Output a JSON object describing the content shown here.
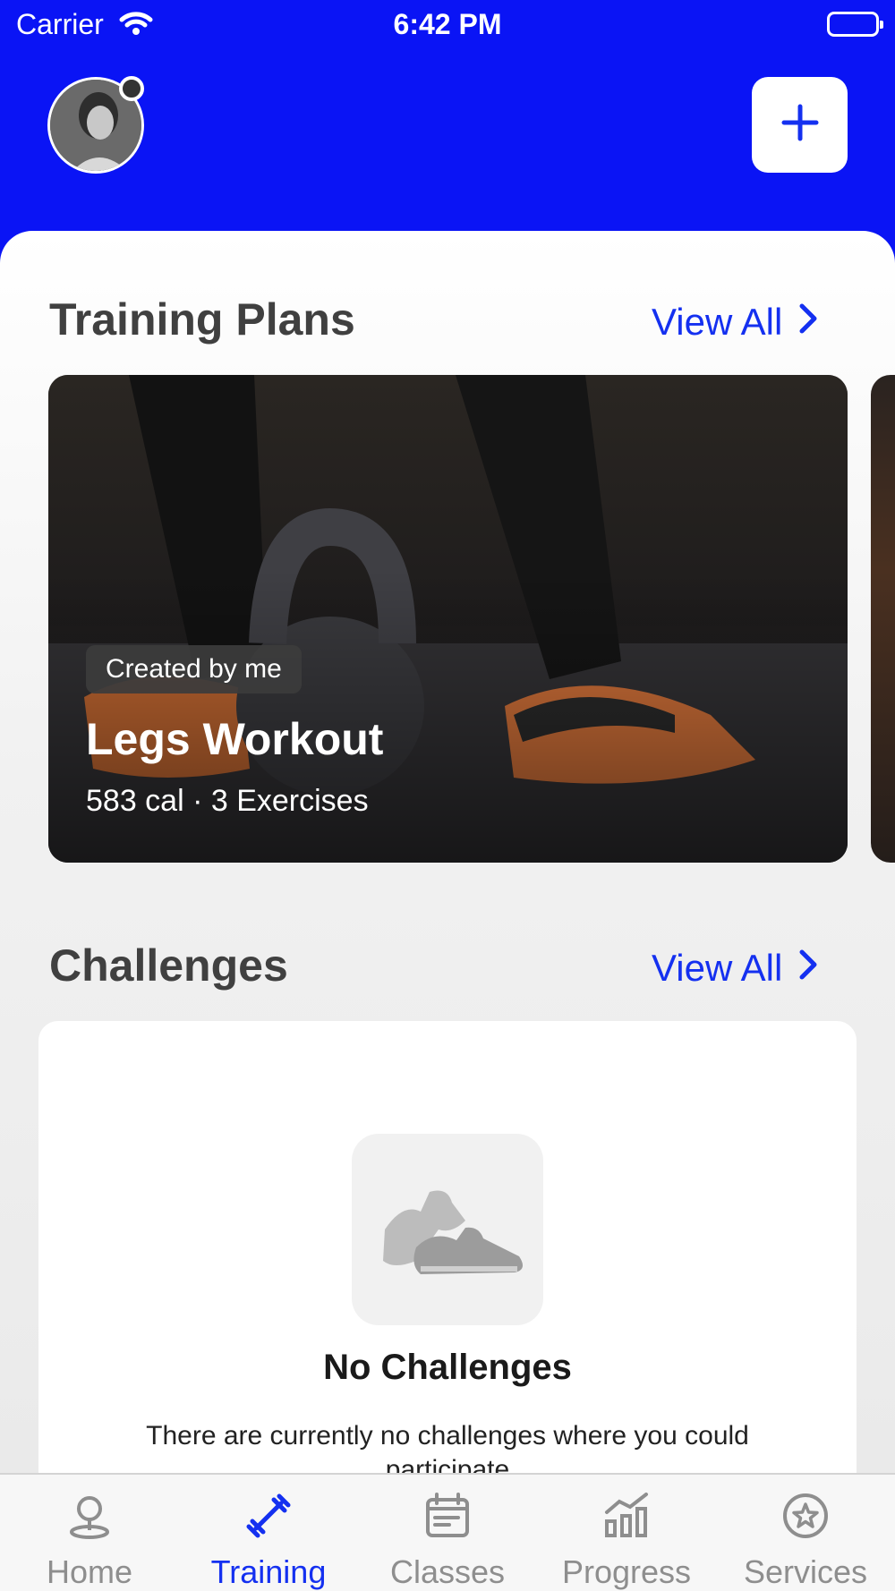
{
  "status_bar": {
    "carrier": "Carrier",
    "time": "6:42 PM",
    "wifi_icon": "wifi-icon",
    "battery_icon": "battery-icon"
  },
  "header": {
    "avatar": "user-avatar",
    "add_icon": "plus-icon"
  },
  "training_plans": {
    "title": "Training Plans",
    "view_all": "View All",
    "cards": [
      {
        "badge": "Created by me",
        "title": "Legs Workout",
        "meta": "583 cal · 3 Exercises"
      }
    ]
  },
  "challenges": {
    "title": "Challenges",
    "view_all": "View All",
    "empty_title": "No Challenges",
    "empty_text": "There are currently no challenges where you could participate"
  },
  "tab_bar": {
    "active_index": 1,
    "tabs": [
      {
        "label": "Home",
        "icon": "home-location-icon"
      },
      {
        "label": "Training",
        "icon": "dumbbell-icon"
      },
      {
        "label": "Classes",
        "icon": "calendar-icon"
      },
      {
        "label": "Progress",
        "icon": "chart-icon"
      },
      {
        "label": "Services",
        "icon": "star-icon"
      }
    ]
  },
  "colors": {
    "brand_blue": "#0a14f5",
    "link_blue": "#1430f0",
    "inactive_gray": "#8e8e8e"
  }
}
